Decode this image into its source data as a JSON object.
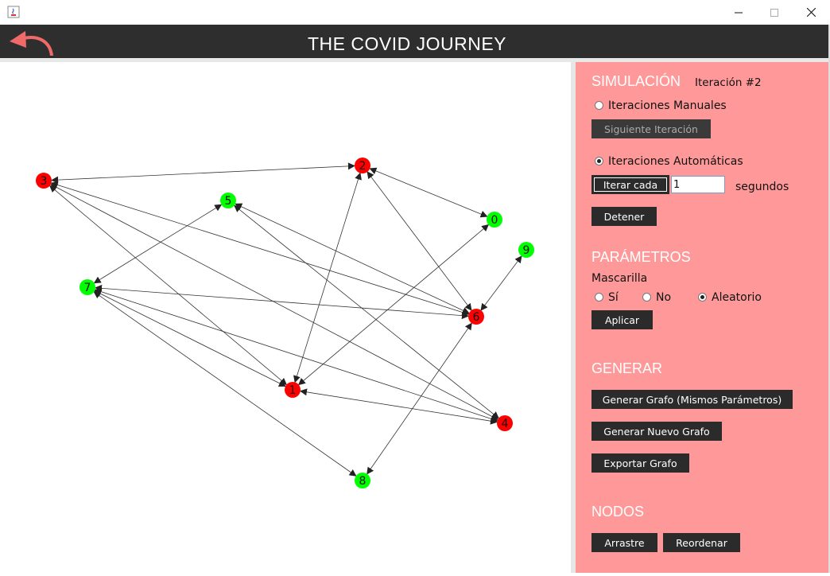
{
  "window": {
    "min_icon": "minimize-icon",
    "max_icon": "maximize-icon",
    "close_icon": "close-icon"
  },
  "header": {
    "title": "THE COVID JOURNEY",
    "back_icon": "back-arrow-icon",
    "back_color": "#f06a6a"
  },
  "colors": {
    "infected": "#ff0000",
    "healthy": "#00ff00",
    "panel": "#ff9999",
    "header": "#2e2e2e"
  },
  "graph": {
    "nodes": [
      {
        "id": "0",
        "status": "healthy"
      },
      {
        "id": "1",
        "status": "infected"
      },
      {
        "id": "2",
        "status": "infected"
      },
      {
        "id": "3",
        "status": "infected"
      },
      {
        "id": "4",
        "status": "infected"
      },
      {
        "id": "5",
        "status": "healthy"
      },
      {
        "id": "6",
        "status": "infected"
      },
      {
        "id": "7",
        "status": "healthy"
      },
      {
        "id": "8",
        "status": "healthy"
      },
      {
        "id": "9",
        "status": "healthy"
      }
    ],
    "edges": [
      [
        "3",
        "2"
      ],
      [
        "2",
        "0"
      ],
      [
        "2",
        "1"
      ],
      [
        "2",
        "6"
      ],
      [
        "0",
        "1"
      ],
      [
        "9",
        "6"
      ],
      [
        "3",
        "6"
      ],
      [
        "3",
        "1"
      ],
      [
        "3",
        "4"
      ],
      [
        "5",
        "7"
      ],
      [
        "5",
        "6"
      ],
      [
        "5",
        "4"
      ],
      [
        "7",
        "6"
      ],
      [
        "7",
        "1"
      ],
      [
        "7",
        "4"
      ],
      [
        "7",
        "8"
      ],
      [
        "6",
        "8"
      ],
      [
        "4",
        "1"
      ]
    ]
  },
  "simulation": {
    "title": "SIMULACIÓN",
    "iteration": "Iteración #2",
    "manual_label": "Iteraciones Manuales",
    "next_button": "Siguiente Iteración",
    "auto_label": "Iteraciones Automáticas",
    "iterate_button": "Iterar cada",
    "interval_value": "1",
    "seconds_label": "segundos",
    "stop_button": "Detener",
    "mode_selected": "auto"
  },
  "parameters": {
    "title": "PARÁMETROS",
    "mask_label": "Mascarilla",
    "options": [
      "Sí",
      "No",
      "Aleatorio"
    ],
    "selected": "Aleatorio",
    "apply_button": "Aplicar"
  },
  "generate": {
    "title": "GENERAR",
    "same_params_button": "Generar Grafo (Mismos Parámetros)",
    "new_graph_button": "Generar Nuevo Grafo",
    "export_button": "Exportar Grafo"
  },
  "nodes_section": {
    "title": "NODOS",
    "drag_button": "Arrastre",
    "reorder_button": "Reordenar"
  }
}
